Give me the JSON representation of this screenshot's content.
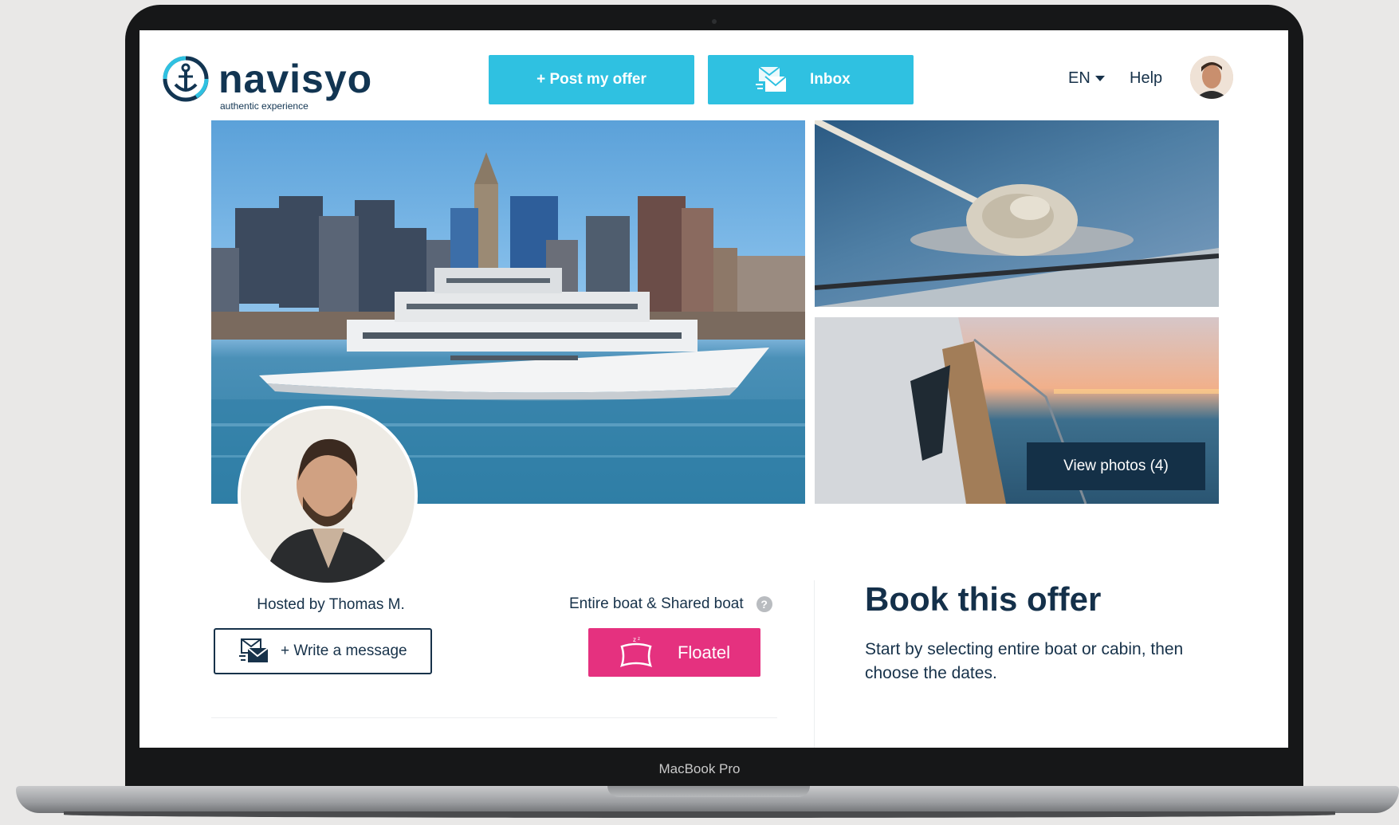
{
  "device": {
    "model_label": "MacBook Pro"
  },
  "header": {
    "logo_name": "navisyo",
    "logo_tagline": "authentic experience",
    "post_offer_label": "+ Post my offer",
    "inbox_label": "Inbox",
    "language": "EN",
    "help_label": "Help",
    "avatar_icon": "user-avatar-photo"
  },
  "gallery": {
    "view_photos_label": "View photos (4)"
  },
  "host": {
    "hosted_by": "Hosted by Thomas M.",
    "write_message_label": "+ Write a message"
  },
  "offer": {
    "boat_type": "Entire boat & Shared boat",
    "help_icon": "?",
    "floatel_label": "Floatel"
  },
  "booking": {
    "title": "Book this offer",
    "description": "Start by selecting entire boat or cabin, then choose the dates."
  },
  "colors": {
    "accent": "#2fc1e1",
    "navy": "#143047",
    "pink": "#e5317f",
    "text": "#17324a"
  }
}
